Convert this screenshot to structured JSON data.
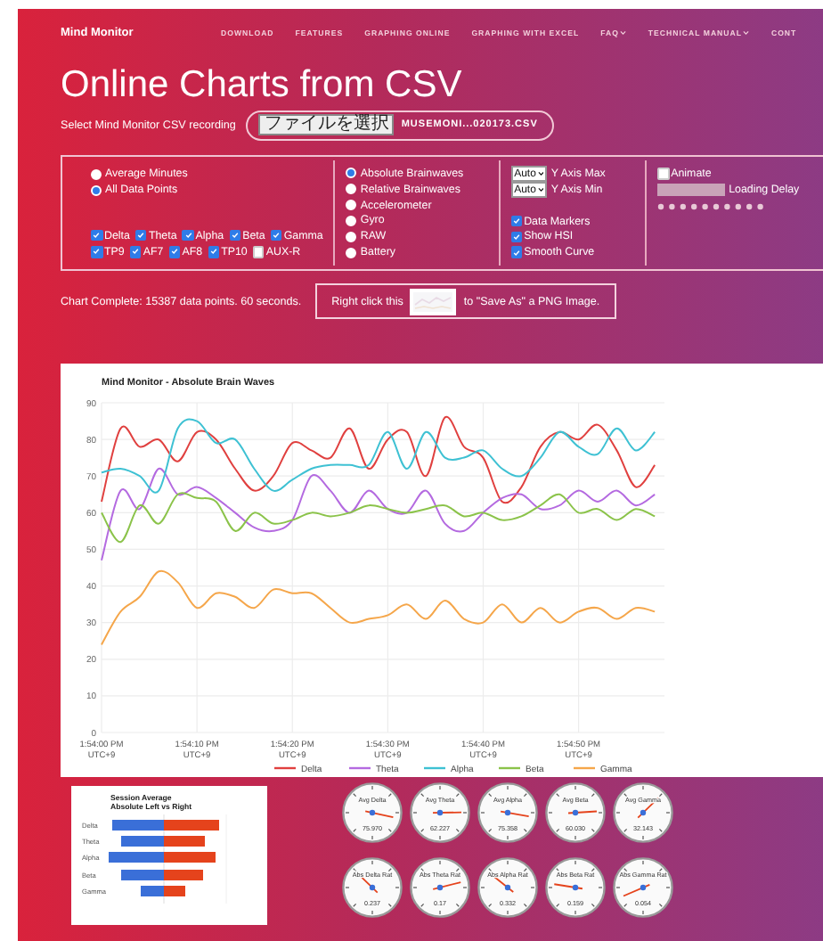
{
  "nav": {
    "brand": "Mind Monitor",
    "items": [
      {
        "label": "DOWNLOAD",
        "dropdown": false
      },
      {
        "label": "FEATURES",
        "dropdown": false
      },
      {
        "label": "GRAPHING ONLINE",
        "dropdown": false
      },
      {
        "label": "GRAPHING WITH EXCEL",
        "dropdown": false
      },
      {
        "label": "FAQ",
        "dropdown": true
      },
      {
        "label": "TECHNICAL MANUAL",
        "dropdown": true
      },
      {
        "label": "CONT",
        "dropdown": false
      }
    ]
  },
  "page_title": "Online Charts from CSV",
  "file_picker": {
    "label": "Select Mind Monitor CSV recording",
    "button": "ファイルを選択",
    "file_name": "MUSEMONI...020173.CSV"
  },
  "options": {
    "range": [
      {
        "label": "Average Minutes",
        "selected": false
      },
      {
        "label": "All Data Points",
        "selected": true
      }
    ],
    "bands": [
      {
        "label": "Delta",
        "checked": true
      },
      {
        "label": "Theta",
        "checked": true
      },
      {
        "label": "Alpha",
        "checked": true
      },
      {
        "label": "Beta",
        "checked": true
      },
      {
        "label": "Gamma",
        "checked": true
      }
    ],
    "sensors": [
      {
        "label": "TP9",
        "checked": true
      },
      {
        "label": "AF7",
        "checked": true
      },
      {
        "label": "AF8",
        "checked": true
      },
      {
        "label": "TP10",
        "checked": true
      },
      {
        "label": "AUX-R",
        "checked": false
      }
    ],
    "modes": [
      {
        "label": "Absolute Brainwaves",
        "selected": true
      },
      {
        "label": "Relative Brainwaves",
        "selected": false
      },
      {
        "label": "Accelerometer",
        "selected": false
      },
      {
        "label": "Gyro",
        "selected": false
      },
      {
        "label": "RAW",
        "selected": false
      },
      {
        "label": "Battery",
        "selected": false
      }
    ],
    "y_axis": [
      {
        "value": "Auto",
        "label": "Y Axis Max"
      },
      {
        "value": "Auto",
        "label": "Y Axis Min"
      }
    ],
    "display": [
      {
        "label": "Data Markers",
        "checked": true
      },
      {
        "label": "Show HSI",
        "checked": true
      },
      {
        "label": "Smooth Curve",
        "checked": true
      }
    ],
    "animate": {
      "label": "Animate",
      "checked": false
    },
    "loading_delay": {
      "label": "Loading Delay"
    }
  },
  "status": "Chart Complete: 15387 data points. 60 seconds.",
  "save_hint": {
    "before": "Right click this",
    "after": "to \"Save As\" a PNG Image."
  },
  "main_chart": {
    "chart_data": {
      "type": "line",
      "title": "Mind Monitor - Absolute Brain Waves",
      "categories": [
        "1:54:00 PM UTC+9",
        null,
        null,
        null,
        null,
        "1:54:10 PM UTC+9",
        null,
        null,
        null,
        null,
        "1:54:20 PM UTC+9",
        null,
        null,
        null,
        null,
        "1:54:30 PM UTC+9",
        null,
        null,
        null,
        null,
        "1:54:40 PM UTC+9",
        null,
        null,
        null,
        null,
        "1:54:50 PM UTC+9",
        null,
        null,
        null,
        null
      ],
      "series": [
        {
          "name": "Delta",
          "color": "#e0403f",
          "values": [
            63,
            83,
            78,
            80,
            74,
            82,
            80,
            72,
            66,
            70,
            79,
            77,
            75,
            83,
            72,
            80,
            82,
            70,
            86,
            78,
            75,
            63,
            67,
            78,
            82,
            80,
            84,
            77,
            67,
            73
          ]
        },
        {
          "name": "Theta",
          "color": "#b46ae0",
          "values": [
            47,
            66,
            61,
            72,
            65,
            67,
            64,
            60,
            56,
            55,
            58,
            70,
            66,
            60,
            66,
            61,
            60,
            66,
            57,
            55,
            60,
            64,
            65,
            61,
            62,
            66,
            63,
            66,
            62,
            65
          ]
        },
        {
          "name": "Alpha",
          "color": "#3ec1d3",
          "values": [
            71,
            72,
            70,
            66,
            83,
            85,
            79,
            80,
            72,
            66,
            69,
            72,
            73,
            73,
            73,
            82,
            72,
            82,
            75,
            75,
            77,
            72,
            70,
            75,
            82,
            78,
            76,
            83,
            77,
            82
          ]
        },
        {
          "name": "Beta",
          "color": "#8bc34a",
          "values": [
            60,
            52,
            62,
            57,
            65,
            64,
            63,
            55,
            60,
            57,
            58,
            60,
            59,
            60,
            62,
            61,
            60,
            61,
            62,
            59,
            60,
            58,
            59,
            62,
            65,
            60,
            61,
            58,
            61,
            59
          ]
        },
        {
          "name": "Gamma",
          "color": "#f5a64a",
          "values": [
            24,
            33,
            37,
            44,
            41,
            34,
            38,
            37,
            34,
            39,
            38,
            38,
            34,
            30,
            31,
            32,
            35,
            31,
            36,
            31,
            30,
            35,
            30,
            34,
            30,
            33,
            34,
            31,
            34,
            33
          ]
        }
      ],
      "ylim": [
        0,
        90
      ],
      "grid": true,
      "legend": true,
      "yticks": [
        0,
        10,
        20,
        30,
        40,
        50,
        60,
        70,
        80,
        90
      ]
    }
  },
  "side_chart": {
    "title": "Session Average Absolute Left vs Right",
    "categories": [
      "Delta",
      "Theta",
      "Alpha",
      "Beta",
      "Gamma"
    ]
  },
  "gauges": [
    {
      "label": "Avg Delta",
      "reading": "75.970"
    },
    {
      "label": "Avg Theta",
      "reading": "62.227"
    },
    {
      "label": "Avg Alpha",
      "reading": "75.358"
    },
    {
      "label": "Avg Beta",
      "reading": "60.030"
    },
    {
      "label": "Avg Gamma",
      "reading": "32.143"
    },
    {
      "label": "Abs Delta Rat",
      "reading": "0.237"
    },
    {
      "label": "Abs Theta Rat",
      "reading": "0.17"
    },
    {
      "label": "Abs Alpha Rat",
      "reading": "0.332"
    },
    {
      "label": "Abs Beta Rat",
      "reading": "0.159"
    },
    {
      "label": "Abs Gamma Rat",
      "reading": "0.054"
    }
  ]
}
